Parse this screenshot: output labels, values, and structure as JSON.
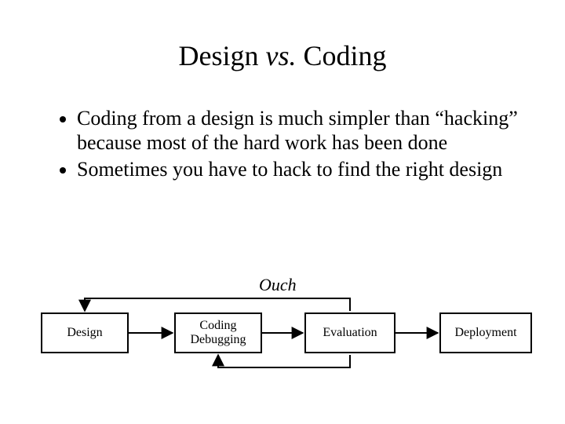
{
  "title_pre": "Design ",
  "title_vs": "vs.",
  "title_post": " Coding",
  "bullets": [
    "Coding from a design is much simpler than “hacking” because most of the hard work has been done",
    "Sometimes you have to hack to find the right design"
  ],
  "diagram": {
    "ouch_label": "Ouch",
    "boxes": {
      "design": "Design",
      "coding": "Coding\nDebugging",
      "evaluation": "Evaluation",
      "deployment": "Deployment"
    }
  }
}
